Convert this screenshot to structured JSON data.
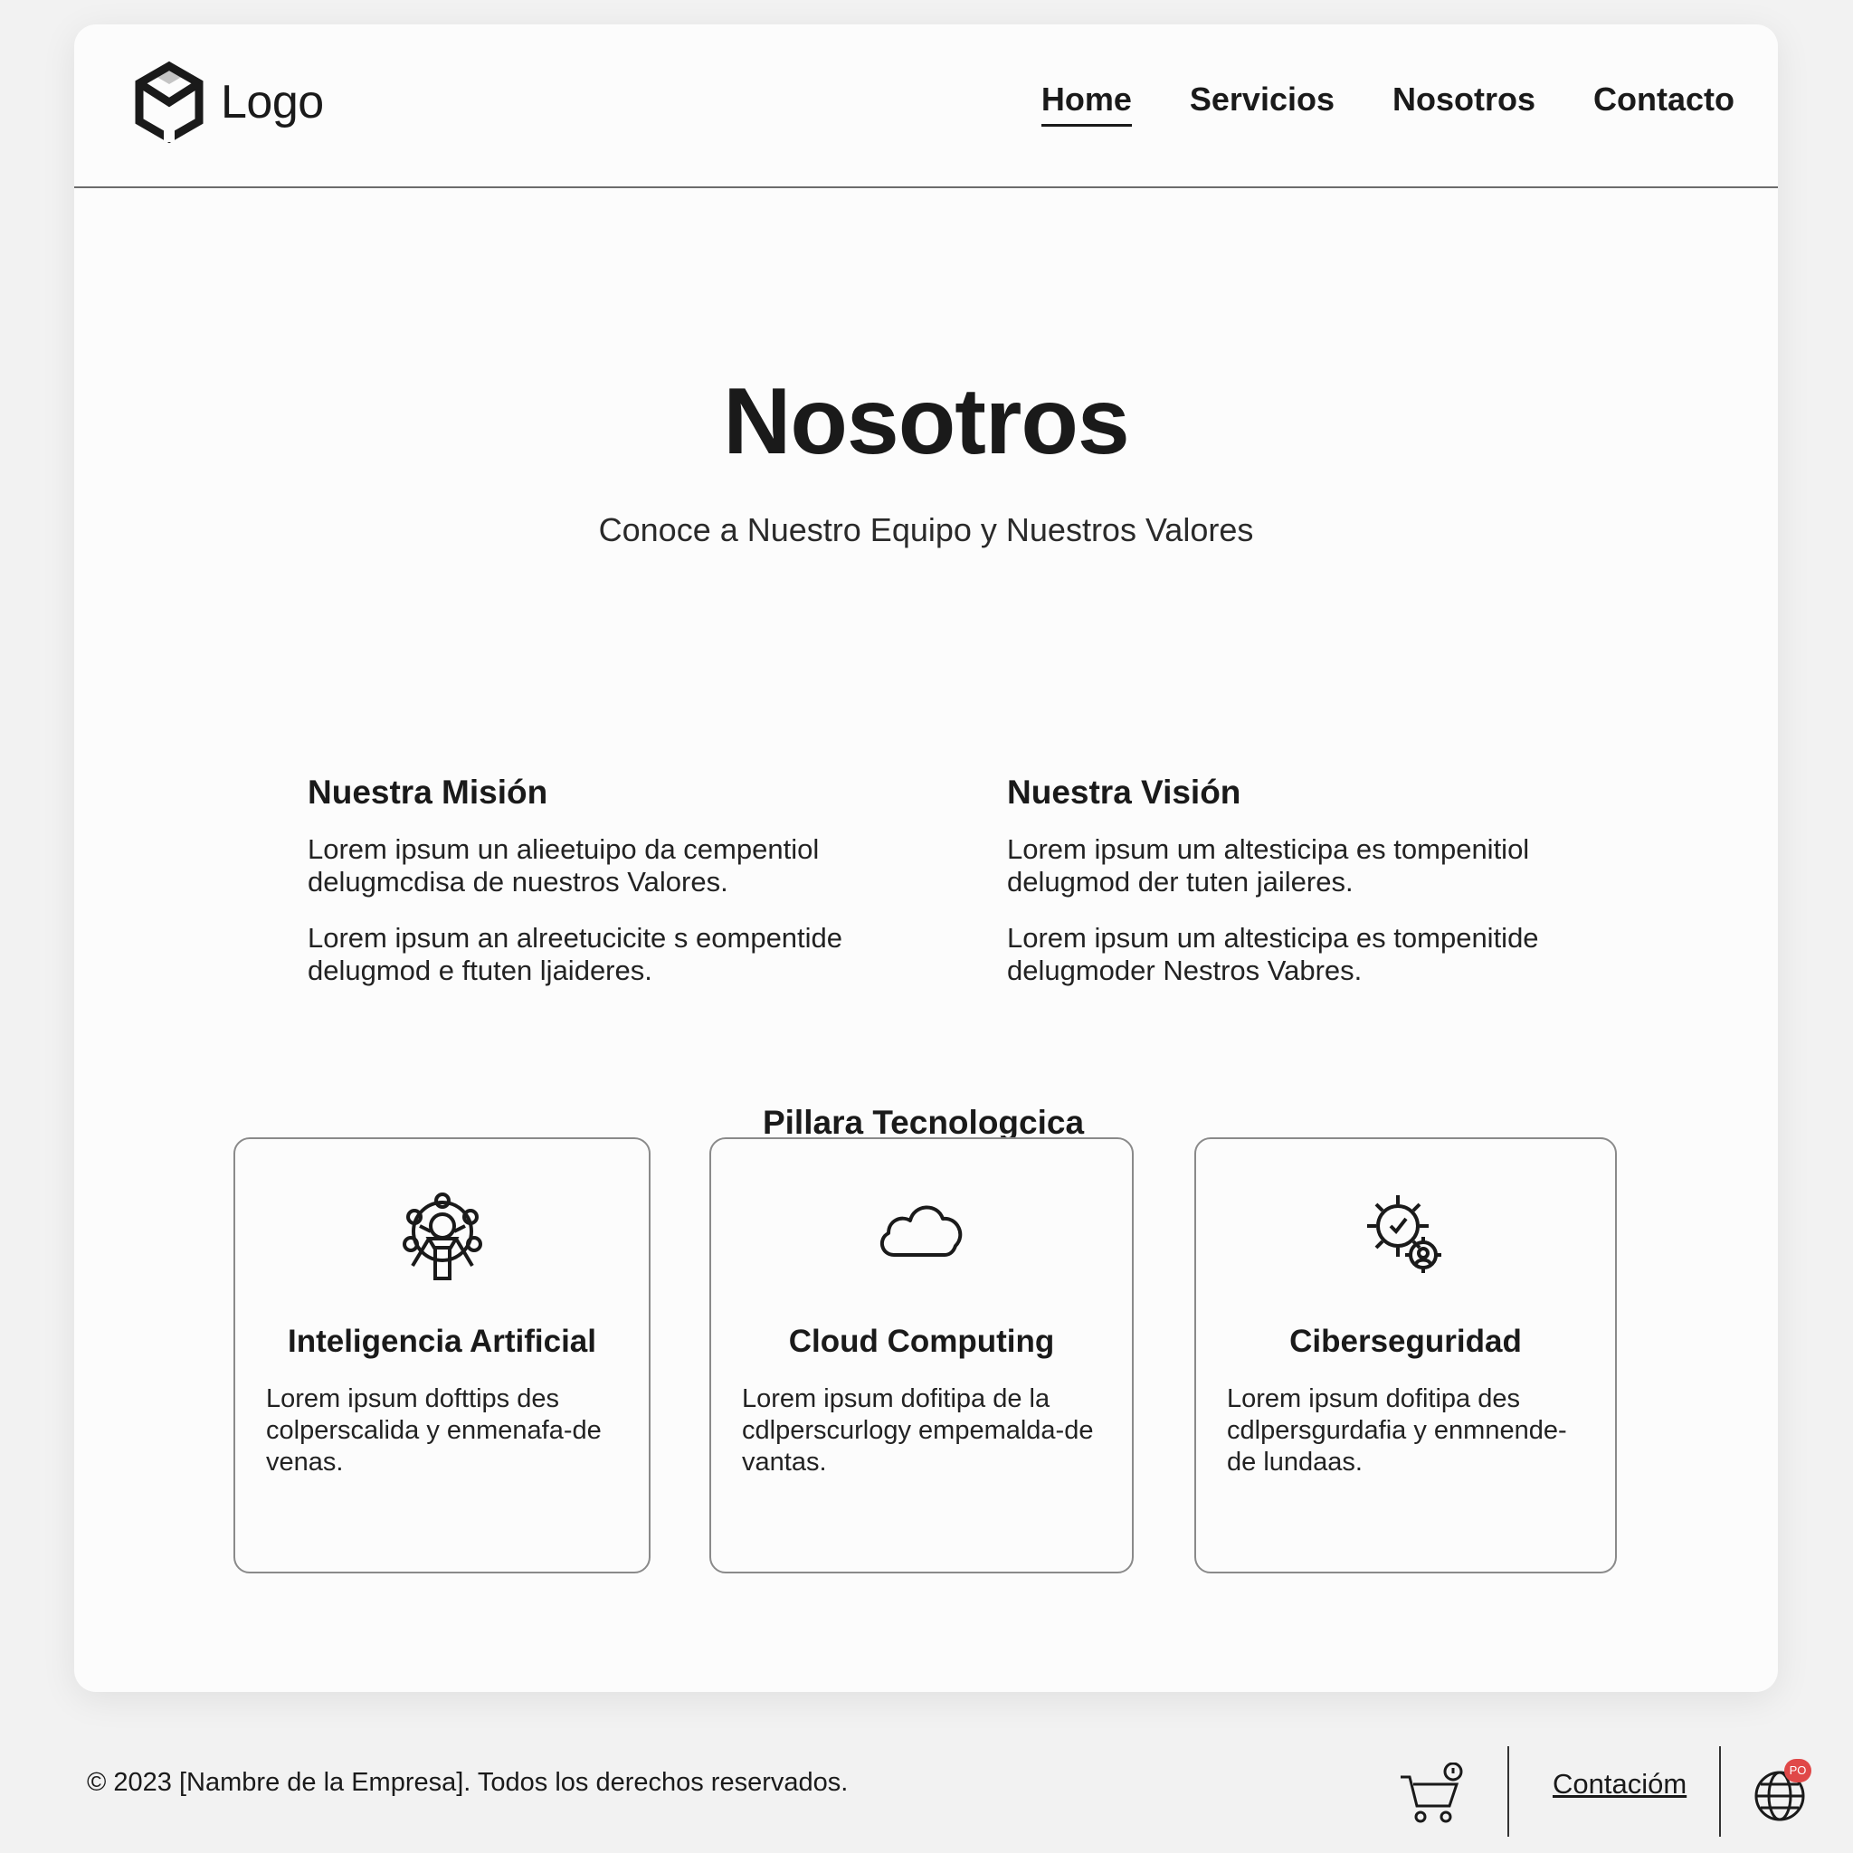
{
  "header": {
    "logo_text": "Logo",
    "nav": [
      {
        "label": "Home",
        "active": true
      },
      {
        "label": "Servicios",
        "active": false
      },
      {
        "label": "Nosotros",
        "active": false
      },
      {
        "label": "Contacto",
        "active": false
      }
    ]
  },
  "hero": {
    "title": "Nosotros",
    "subtitle": "Conoce a Nuestro Equipo y Nuestros Valores"
  },
  "mission": {
    "title": "Nuestra Misión",
    "paragraphs": [
      "Lorem ipsum un alieetuipo da cempentiol delugmcdisa de nuestros Valores.",
      "Lorem ipsum an alreetucicite s eompentide delugmod e ftuten ljaideres."
    ]
  },
  "vision": {
    "title": "Nuestra Visión",
    "paragraphs": [
      "Lorem ipsum um altesticipa es tompenitiol delugmod der tuten jaileres.",
      "Lorem ipsum um altesticipa es tompenitide delugmoder Nestros Vabres."
    ]
  },
  "pillars": {
    "title": "Pillara Tecnologcica",
    "items": [
      {
        "icon": "ai-network-icon",
        "title": "Inteligencia Artificial",
        "text": "Lorem ipsum dofttips des colperscalida y enmenafa-de venas."
      },
      {
        "icon": "cloud-icon",
        "title": "Cloud Computing",
        "text": "Lorem ipsum dofitipa de la cdlperscurlogy empemalda-de vantas."
      },
      {
        "icon": "security-gear-icon",
        "title": "Ciberseguridad",
        "text": "Lorem ipsum dofitipa des cdlpersgurdafia y enmnende-de lundaas."
      }
    ]
  },
  "footer": {
    "copyright": "© 2023 [Nambre de la Empresa]. Todos los derechos reservados.",
    "contact_link": "Contacióm",
    "cart_icon": "cart-icon",
    "globe_icon": "globe-icon",
    "badge": "PO"
  }
}
